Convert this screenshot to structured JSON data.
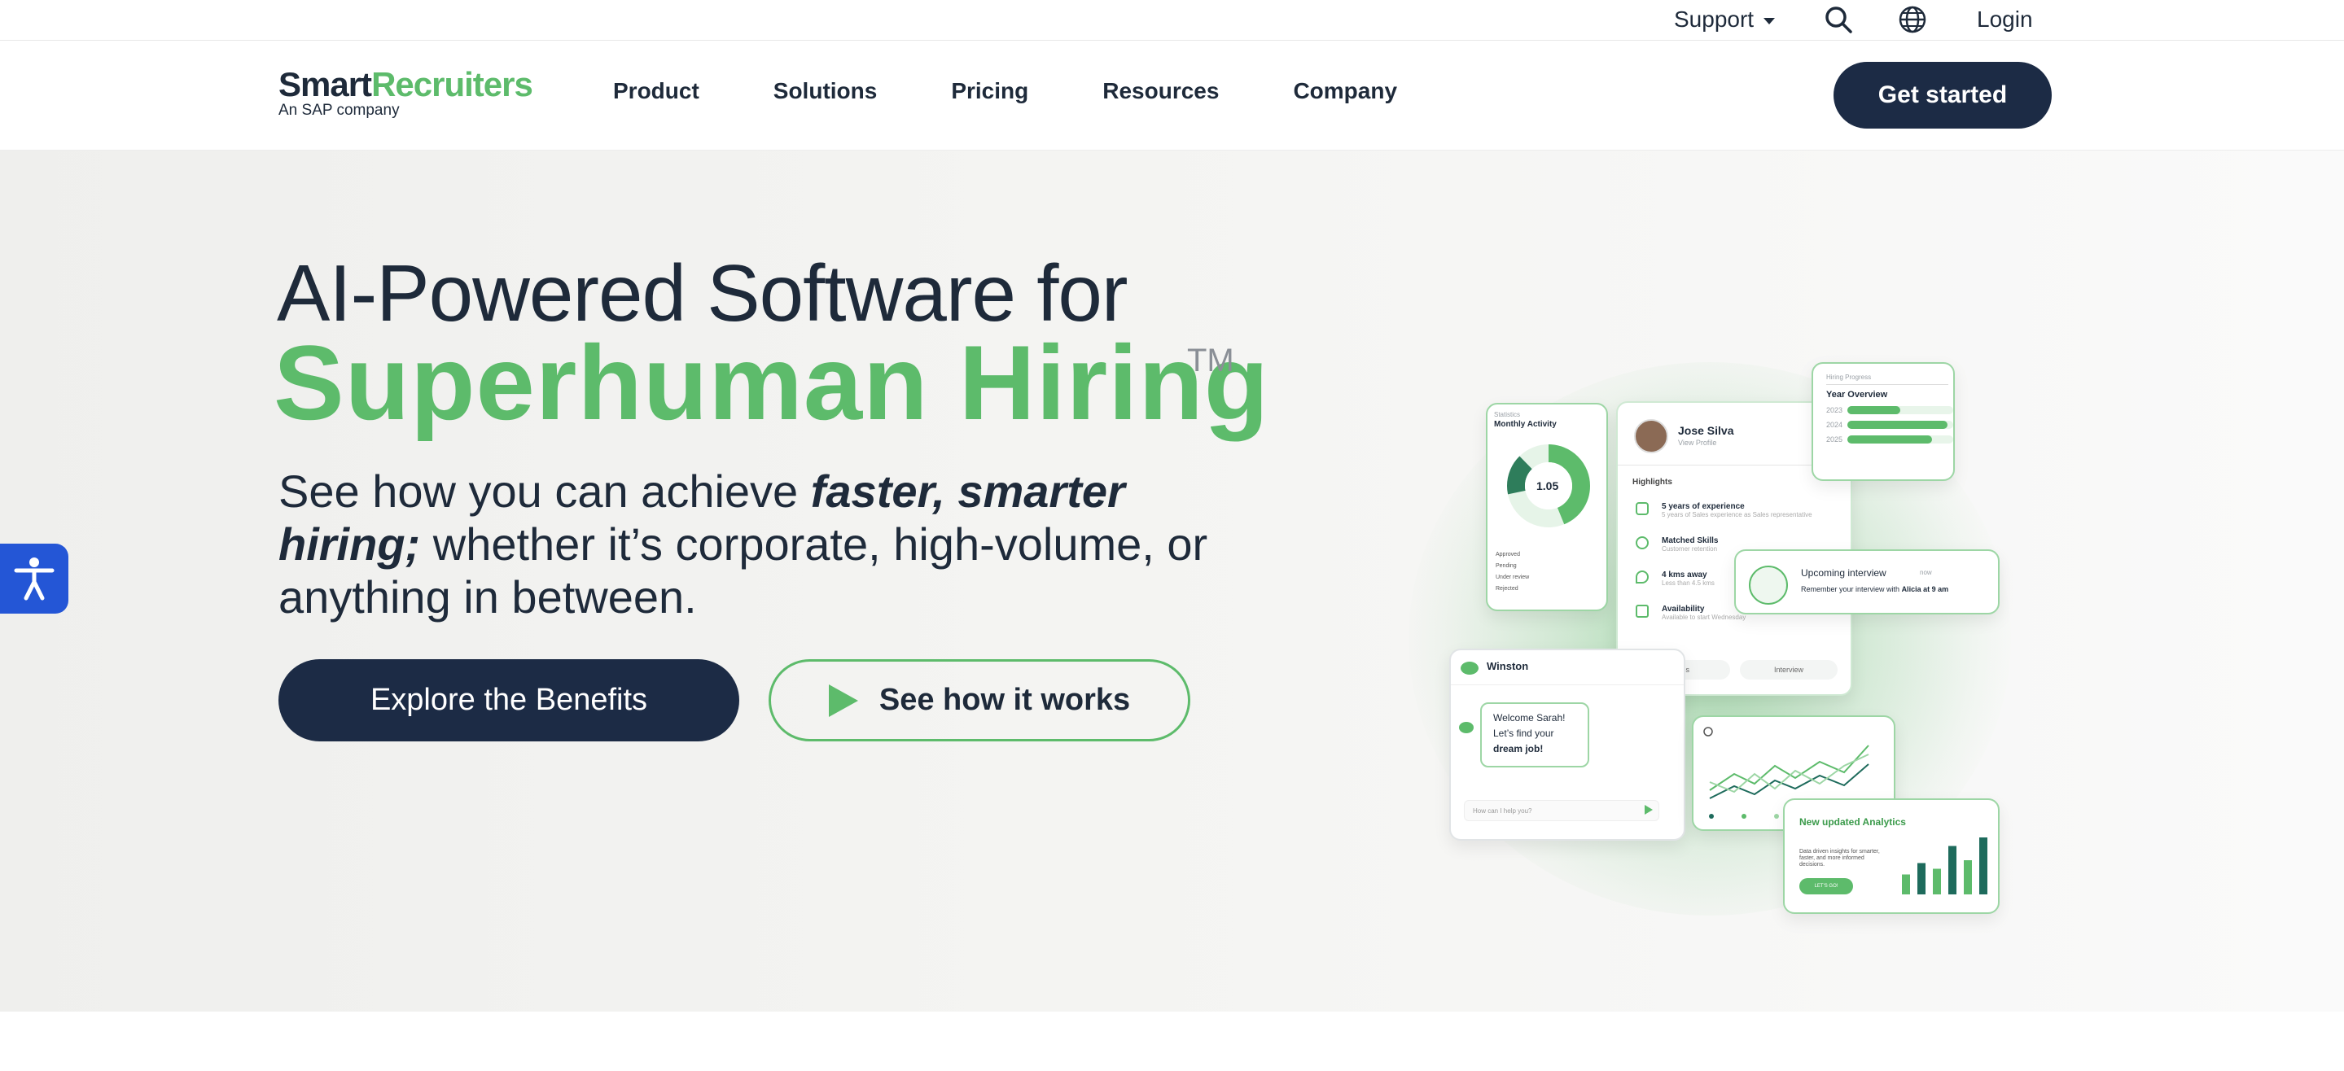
{
  "utility": {
    "support": "Support",
    "login": "Login"
  },
  "logo": {
    "part1": "Smart",
    "part2": "Recruiters",
    "tagline": "An SAP company"
  },
  "nav": {
    "items": [
      "Product",
      "Solutions",
      "Pricing",
      "Resources",
      "Company"
    ],
    "cta": "Get started"
  },
  "hero": {
    "title_line1": "AI-Powered Software for",
    "title_line2": "Superhuman Hiring",
    "trademark": "TM",
    "subtitle_pre": "See how you can achieve ",
    "subtitle_emphasis": "faster, smarter hiring;",
    "subtitle_post": " whether it’s corporate, high-volume, or anything in between.",
    "primary_button": "Explore the Benefits",
    "secondary_button": "See how it works"
  },
  "illustration": {
    "activity": {
      "label": "Statistics",
      "title": "Monthly Activity",
      "center_value": "1.05",
      "legend": [
        "Approved",
        "Pending",
        "Under review",
        "Rejected"
      ]
    },
    "candidate": {
      "name": "Jose Silva",
      "link": "View Profile",
      "section": "Highlights",
      "highlights": [
        {
          "title": "5 years of experience",
          "detail": "5 years of Sales experience as Sales representative"
        },
        {
          "title": "Matched Skills",
          "detail": "Customer retention"
        },
        {
          "title": "4 kms away",
          "detail": "Less than 4.5 kms"
        },
        {
          "title": "Availability",
          "detail": "Available to start Wednesday"
        }
      ],
      "buttons": [
        "Pass",
        "Interview"
      ]
    },
    "progress": {
      "label": "Hiring Progress",
      "title": "Year Overview",
      "rows": [
        {
          "year": "2023",
          "value": 0.5
        },
        {
          "year": "2024",
          "value": 0.95
        },
        {
          "year": "2025",
          "value": 0.8
        }
      ]
    },
    "interview": {
      "title": "Upcoming interview",
      "time": "now",
      "text_pre": "Remember your interview with",
      "text_bold": "Alicia at 9 am"
    },
    "winston": {
      "name": "Winston",
      "message_line1": "Welcome Sarah!",
      "message_line2": "Let’s find your",
      "message_line3": "dream job!",
      "input_placeholder": "How can I help you?"
    },
    "analytics": {
      "title": "New updated Analytics",
      "text": "Data driven insights for smarter, faster, and more informed decisions.",
      "button": "LET'S GO!",
      "bars": [
        0.35,
        0.55,
        0.45,
        0.85,
        0.6,
        1.0
      ]
    },
    "colors": {
      "brand_green": "#5dbb6b",
      "navy": "#1c2b45"
    }
  }
}
